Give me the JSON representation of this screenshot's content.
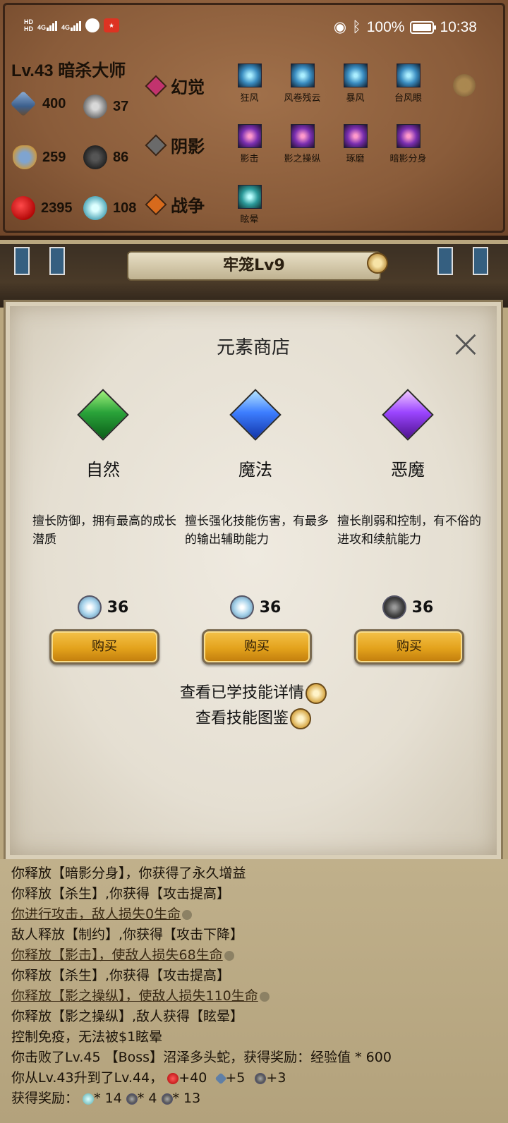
{
  "status_bar": {
    "hd1": "HD",
    "hd2": "HD",
    "net1": "4G",
    "net2": "4G",
    "battery": "100%",
    "time": "10:38"
  },
  "character": {
    "title": "Lv.43 暗杀大师",
    "attack": "400",
    "stat_a": "37",
    "defense": "259",
    "stat_b": "86",
    "hp": "2395",
    "stat_c": "108"
  },
  "elements": [
    {
      "name": "幻觉",
      "color": "#c2336e",
      "skills": [
        "狂风",
        "风卷残云",
        "暴风",
        "台风眼"
      ]
    },
    {
      "name": "阴影",
      "color": "#6a6a6a",
      "skills": [
        "影击",
        "影之操纵",
        "琢磨",
        "暗影分身"
      ]
    },
    {
      "name": "战争",
      "color": "#d76a1c",
      "skills": [
        "眩晕"
      ]
    }
  ],
  "scene": {
    "banner": "牢笼Lv9"
  },
  "shop": {
    "title": "元素商店",
    "close": "×",
    "items": [
      {
        "name": "自然",
        "desc": "擅长防御，拥有最高的成长潜质",
        "price": "36",
        "buy": "购买"
      },
      {
        "name": "魔法",
        "desc": "擅长强化技能伤害，有最多的输出辅助能力",
        "price": "36",
        "buy": "购买"
      },
      {
        "name": "恶魔",
        "desc": "擅长削弱和控制，有不俗的进攻和续航能力",
        "price": "36",
        "buy": "购买"
      }
    ],
    "link_learned": "查看已学技能详情",
    "link_codex": "查看技能图鉴"
  },
  "log": [
    "你释放【暗影分身】，你获得了永久增益",
    "你释放【杀生】,你获得【攻击提高】",
    "你进行攻击，敌人损失0生命",
    "敌人释放【制约】,你获得【攻击下降】",
    "你释放【影击】，使敌人损失68生命",
    "你释放【杀生】,你获得【攻击提高】",
    "你释放【影之操纵】，使敌人损失110生命",
    "你释放【影之操纵】,敌人获得【眩晕】",
    "控制免疫，无法被$1眩晕",
    "你击败了Lv.45 【Boss】沼泽多头蛇，获得奖励：经验值 * 600",
    "你从Lv.43升到了Lv.44，",
    "+40",
    "+5",
    "+3",
    "获得奖励：",
    "* 14",
    "* 4",
    "* 13"
  ]
}
